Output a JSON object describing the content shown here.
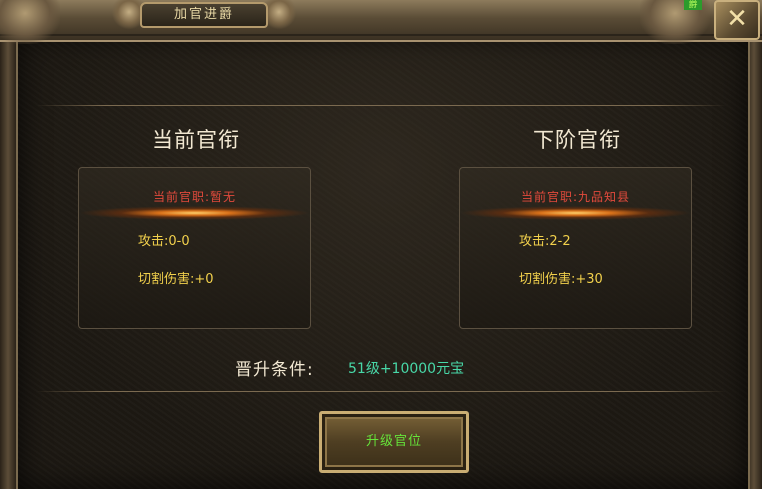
{
  "window": {
    "tab_title": "加官进爵",
    "corner_glyph": "爵",
    "close_icon": "close-icon"
  },
  "current": {
    "heading": "当前官衔",
    "rank_label": "当前官职:",
    "rank_value": "暂无",
    "attack_label": "攻击:",
    "attack_value": "0-0",
    "cut_label": "切割伤害:",
    "cut_value": "+0"
  },
  "next": {
    "heading": "下阶官衔",
    "rank_label": "当前官职:",
    "rank_value": "九品知县",
    "attack_label": "攻击:",
    "attack_value": "2-2",
    "cut_label": "切割伤害:",
    "cut_value": "+30"
  },
  "condition": {
    "label": "晋升条件:",
    "value": "51级+10000元宝"
  },
  "upgrade_button": {
    "label": "升级官位"
  },
  "colors": {
    "rank_text": "#e24a3c",
    "stat_text": "#f1d04c",
    "condition_value": "#48d8a8",
    "button_text": "#66e43a"
  }
}
